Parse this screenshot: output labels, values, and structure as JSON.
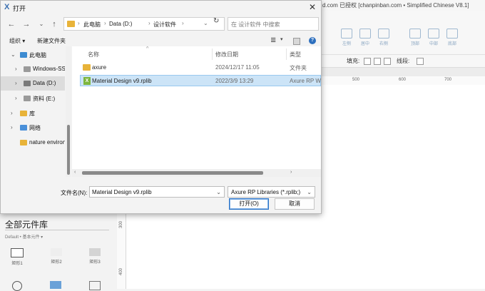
{
  "app": {
    "title_text": "d.com 已授权   [chanpinban.com • Simplified Chinese V8.1]",
    "toolbar_tools": [
      "左侧",
      "居中",
      "右侧",
      "顶部",
      "中部",
      "底部"
    ],
    "fill_label": "填充:",
    "line_label": "线段:",
    "ruler_top_ticks": [
      "500",
      "600",
      "700"
    ],
    "ruler_left_ticks": [
      "300",
      "400"
    ],
    "library_title": "全部元件库",
    "library_subtitle": "Default • 基本元件 ▾",
    "library_items": [
      "矩形1",
      "矩形2",
      "矩形3"
    ]
  },
  "dialog": {
    "title": "打开",
    "title_icon": "axure-x-icon",
    "address": {
      "crumbs": [
        "此电脑",
        "Data (D:)",
        "设计软件"
      ]
    },
    "search_placeholder": "在 设计软件 中搜索",
    "commands": {
      "organize": "组织 ▾",
      "new_folder": "新建文件夹"
    },
    "sidebar": [
      {
        "label": "此电脑",
        "expanded": true,
        "icon": "computer-icon"
      },
      {
        "label": "Windows-SSD",
        "icon": "drive-icon"
      },
      {
        "label": "Data (D:)",
        "selected": true,
        "icon": "drive-icon"
      },
      {
        "label": "资料 (E:)",
        "icon": "drive-icon"
      },
      {
        "label": "库",
        "icon": "folder-icon"
      },
      {
        "label": "网络",
        "icon": "network-icon"
      },
      {
        "label": "nature environment",
        "icon": "folder-icon"
      }
    ],
    "columns": {
      "name": "名称",
      "modified": "修改日期",
      "type": "类型"
    },
    "files": [
      {
        "name": "axure",
        "modified": "2024/12/17 11:05",
        "type": "文件夹",
        "kind": "folder"
      },
      {
        "name": "Material Design v9.rplib",
        "modified": "2022/3/9 13:29",
        "type": "Axure RP Wi",
        "kind": "rplib",
        "selected": true
      }
    ],
    "filename_label": "文件名(N):",
    "filename_value": "Material Design v9.rplib",
    "filetype_value": "Axure RP Libraries (*.rplib;)",
    "open_button": "打开(O)",
    "cancel_button": "取消"
  }
}
